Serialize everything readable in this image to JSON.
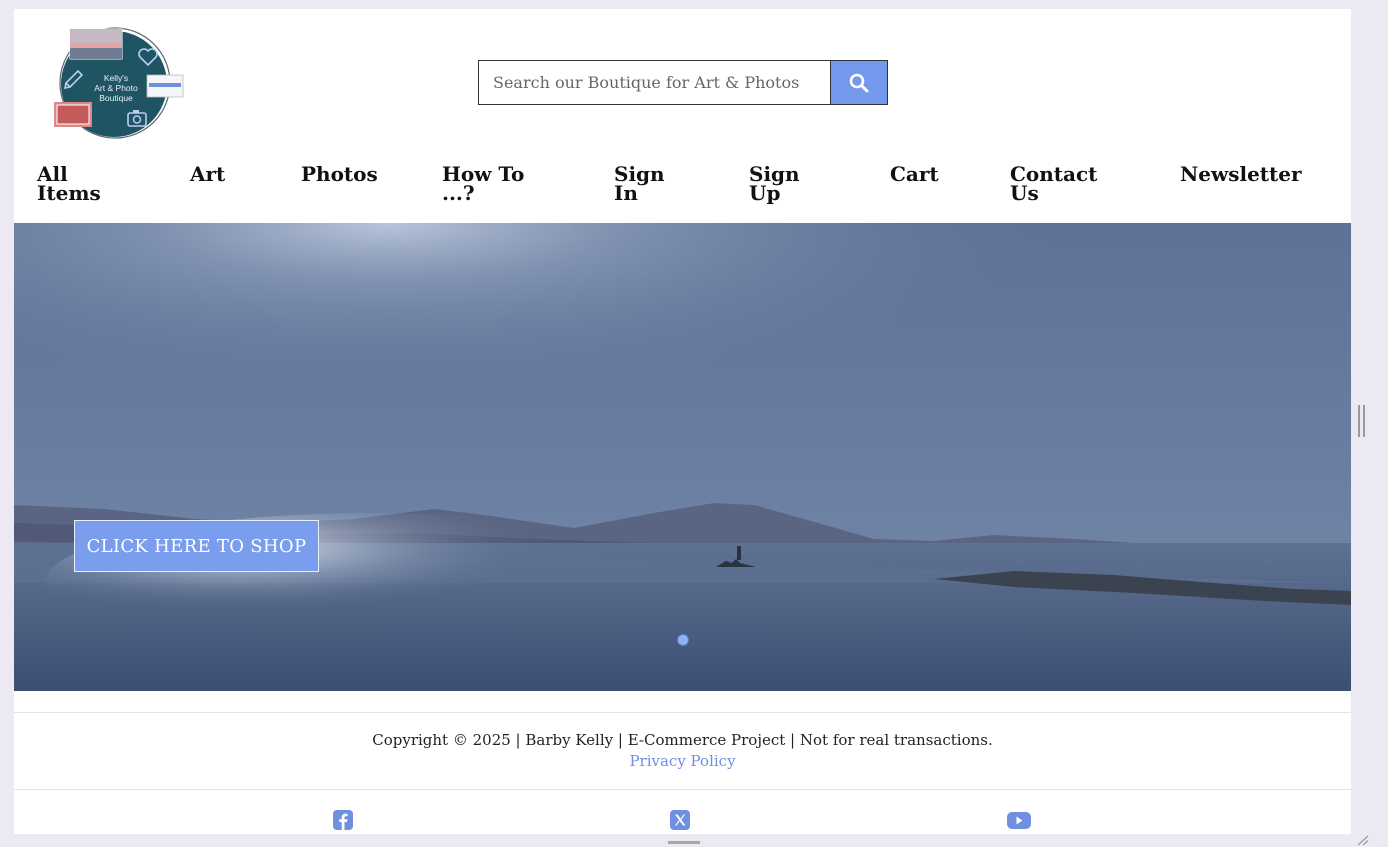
{
  "logo": {
    "line1": "Kelly's",
    "line2": "Art & Photo",
    "line3": "Boutique"
  },
  "search": {
    "placeholder": "Search our Boutique for Art & Photos",
    "button_icon": "search-icon"
  },
  "nav": {
    "items": [
      {
        "lines": [
          "All",
          "Items"
        ]
      },
      {
        "lines": [
          "Art"
        ]
      },
      {
        "lines": [
          "Photos"
        ]
      },
      {
        "lines": [
          "How To",
          "...?"
        ]
      },
      {
        "lines": [
          "Sign",
          "In"
        ]
      },
      {
        "lines": [
          "Sign",
          "Up"
        ]
      },
      {
        "lines": [
          "Cart"
        ]
      },
      {
        "lines": [
          "Contact",
          "Us"
        ]
      },
      {
        "lines": [
          "Newsletter"
        ]
      }
    ]
  },
  "hero": {
    "cta_label": "CLICK HERE TO SHOP"
  },
  "footer": {
    "copyright": "Copyright © 2025 | Barby Kelly | E-Commerce Project | Not for real transactions.",
    "privacy_label": "Privacy Policy",
    "social": [
      "facebook-icon",
      "x-twitter-icon",
      "youtube-icon"
    ]
  },
  "colors": {
    "accent": "#7399ec",
    "link": "#6f8fe0",
    "logo_circle": "#1f5563"
  }
}
